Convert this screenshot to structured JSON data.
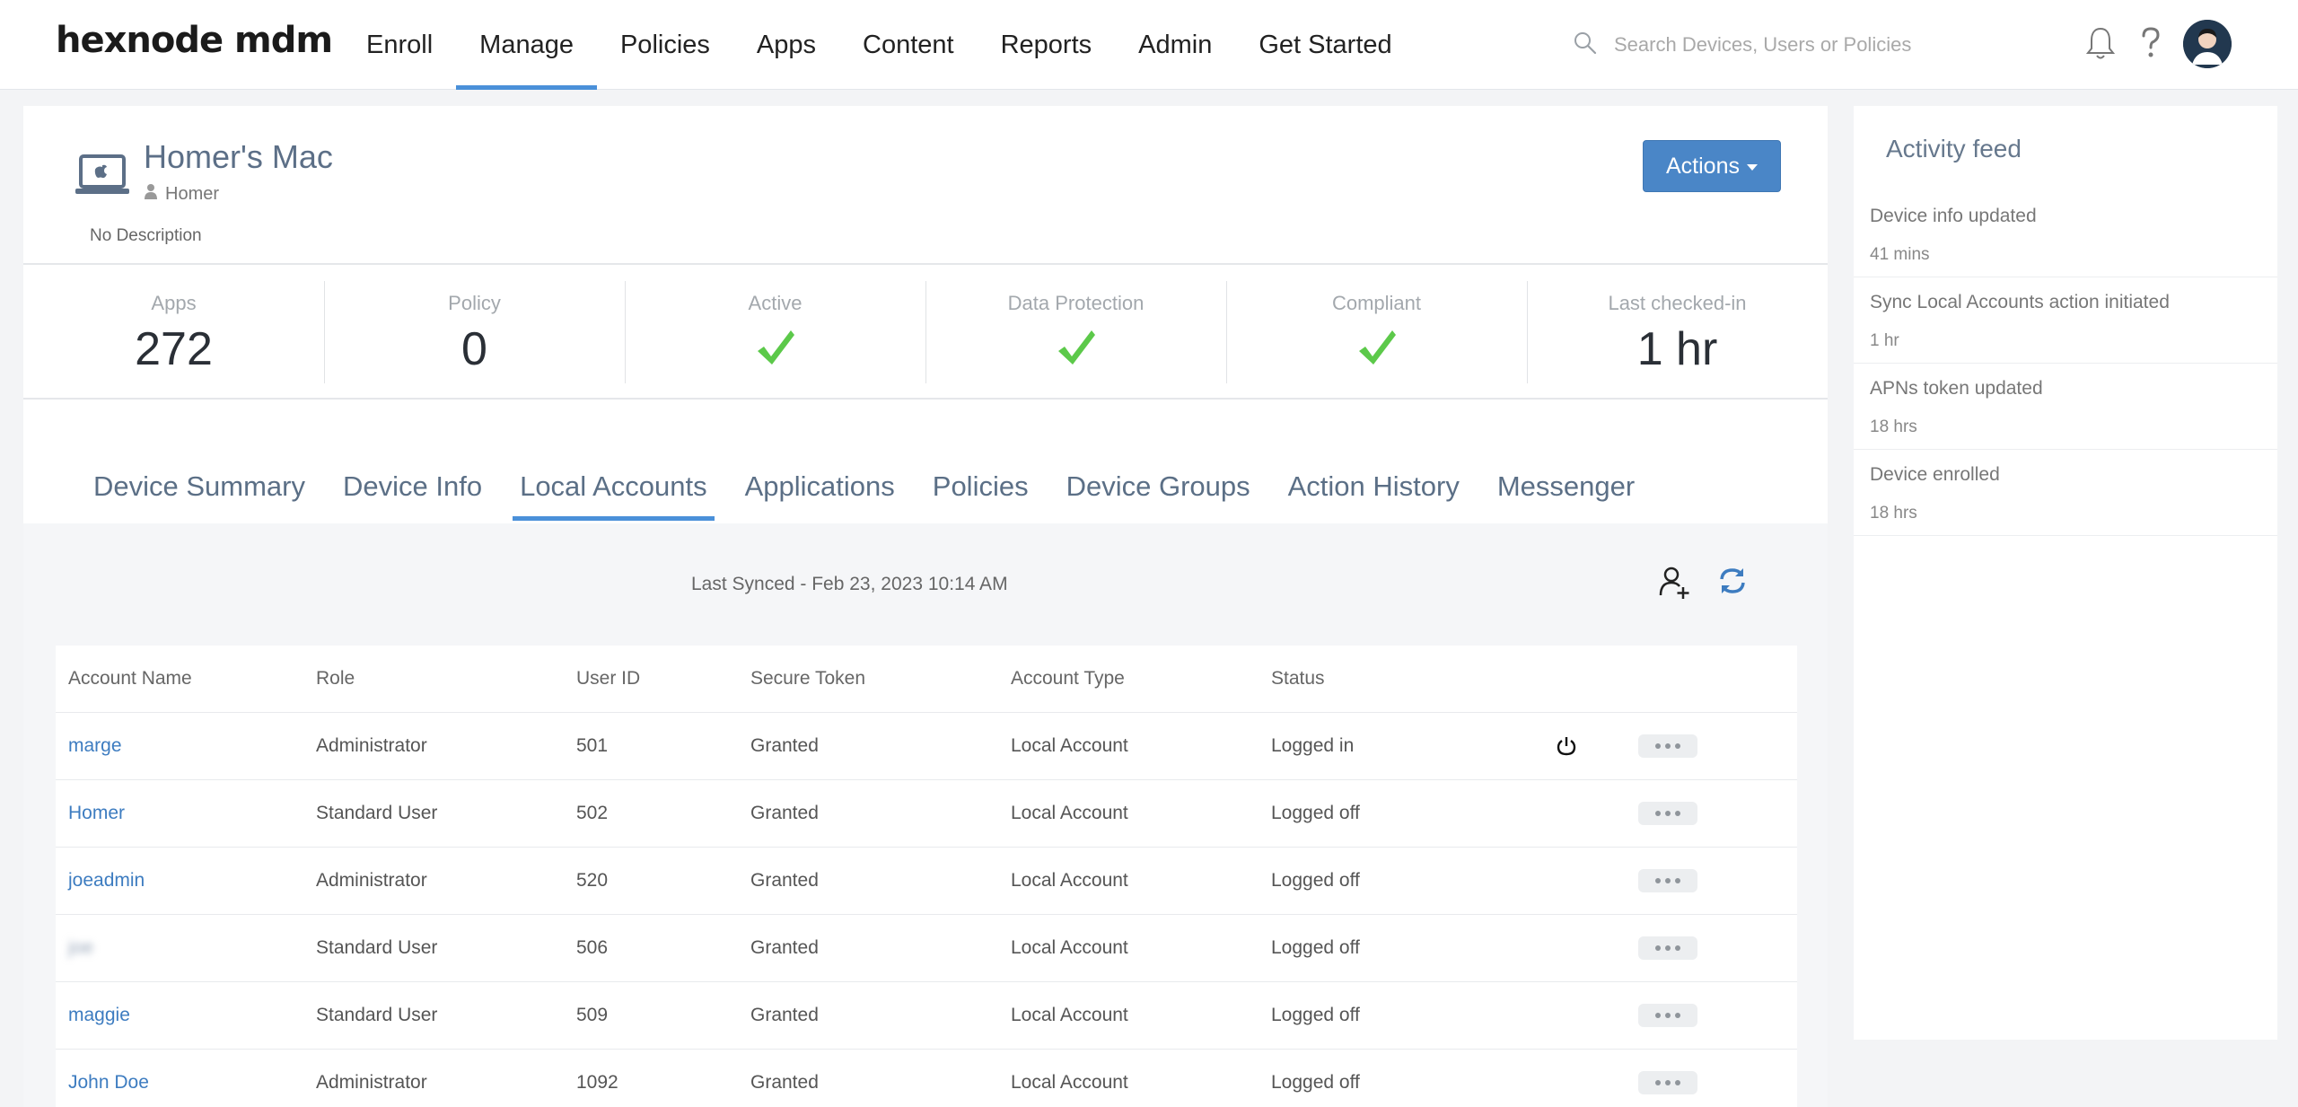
{
  "brand": {
    "logo_text": "hexnode mdm",
    "accent": "#4a90d9"
  },
  "nav": {
    "items": [
      {
        "label": "Enroll"
      },
      {
        "label": "Manage"
      },
      {
        "label": "Policies"
      },
      {
        "label": "Apps"
      },
      {
        "label": "Content"
      },
      {
        "label": "Reports"
      },
      {
        "label": "Admin"
      },
      {
        "label": "Get Started"
      }
    ],
    "active": "Manage"
  },
  "search": {
    "placeholder": "Search Devices, Users or Policies",
    "icon": "search-icon"
  },
  "header_icons": {
    "notifications": "bell-icon",
    "help": "question-icon",
    "profile": "avatar"
  },
  "device": {
    "name": "Homer's Mac",
    "user": "Homer",
    "description": "No Description",
    "actions_label": "Actions"
  },
  "stats": [
    {
      "label": "Apps",
      "value": "272"
    },
    {
      "label": "Policy",
      "value": "0"
    },
    {
      "label": "Active",
      "value": "check"
    },
    {
      "label": "Data Protection",
      "value": "check"
    },
    {
      "label": "Compliant",
      "value": "check"
    },
    {
      "label": "Last checked-in",
      "value": "1 hr"
    }
  ],
  "tabs": [
    {
      "label": "Device Summary"
    },
    {
      "label": "Device Info"
    },
    {
      "label": "Local Accounts"
    },
    {
      "label": "Applications"
    },
    {
      "label": "Policies"
    },
    {
      "label": "Device Groups"
    },
    {
      "label": "Action History"
    },
    {
      "label": "Messenger"
    }
  ],
  "active_tab": "Local Accounts",
  "local_accounts": {
    "last_synced": "Last Synced - Feb 23, 2023 10:14 AM",
    "columns": [
      "Account Name",
      "Role",
      "User ID",
      "Secure Token",
      "Account Type",
      "Status"
    ],
    "rows": [
      {
        "name": "marge",
        "role": "Administrator",
        "uid": "501",
        "token": "Granted",
        "type": "Local Account",
        "status": "Logged in",
        "logout_icon": true
      },
      {
        "name": "Homer",
        "role": "Standard User",
        "uid": "502",
        "token": "Granted",
        "type": "Local Account",
        "status": "Logged off",
        "logout_icon": false
      },
      {
        "name": "joeadmin",
        "role": "Administrator",
        "uid": "520",
        "token": "Granted",
        "type": "Local Account",
        "status": "Logged off",
        "logout_icon": false
      },
      {
        "name": "joe",
        "role": "Standard User",
        "uid": "506",
        "token": "Granted",
        "type": "Local Account",
        "status": "Logged off",
        "logout_icon": false,
        "blurred": true
      },
      {
        "name": "maggie",
        "role": "Standard User",
        "uid": "509",
        "token": "Granted",
        "type": "Local Account",
        "status": "Logged off",
        "logout_icon": false
      },
      {
        "name": "John Doe",
        "role": "Administrator",
        "uid": "1092",
        "token": "Granted",
        "type": "Local Account",
        "status": "Logged off",
        "logout_icon": false
      }
    ]
  },
  "activity_feed": {
    "title": "Activity feed",
    "items": [
      {
        "text": "Device info updated",
        "time": "41 mins"
      },
      {
        "text": "Sync Local Accounts action initiated",
        "time": "1 hr"
      },
      {
        "text": "APNs token updated",
        "time": "18 hrs"
      },
      {
        "text": "Device enrolled",
        "time": "18 hrs"
      }
    ]
  }
}
